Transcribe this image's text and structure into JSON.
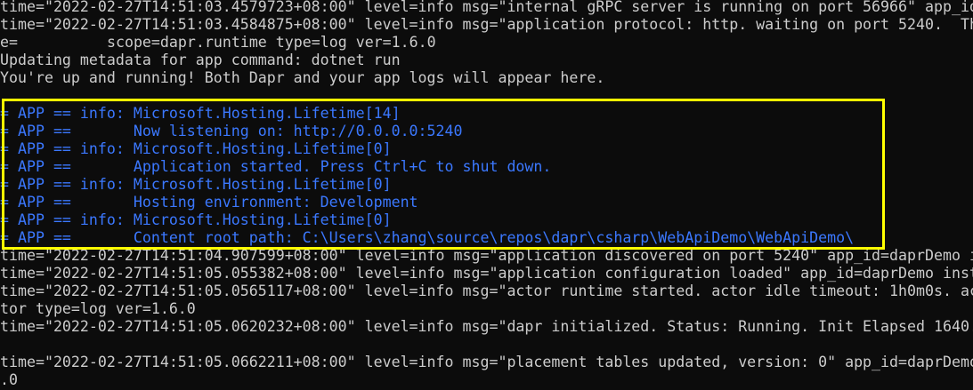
{
  "terminal": {
    "lines": {
      "l0": "time=\"2022-02-27T14:51:03.4579723+08:00\" level=info msg=\"internal gRPC server is running on port 56966\" app_id",
      "l1": "time=\"2022-02-27T14:51:03.4584875+08:00\" level=info msg=\"application protocol: http. waiting on port 5240.  Th",
      "l2_prefix": "e=",
      "l2_suffix": " scope=dapr.runtime type=log ver=1.6.0",
      "l3": "Updating metadata for app command: dotnet run",
      "l4": "You're up and running! Both Dapr and your app logs will appear here.",
      "l6": "= APP == info: Microsoft.Hosting.Lifetime[14]",
      "l7": "= APP ==       Now listening on: http://0.0.0.0:5240",
      "l8": "= APP == info: Microsoft.Hosting.Lifetime[0]",
      "l9": "= APP ==       Application started. Press Ctrl+C to shut down.",
      "l10": "= APP == info: Microsoft.Hosting.Lifetime[0]",
      "l11": "= APP ==       Hosting environment: Development",
      "l12": "= APP == info: Microsoft.Hosting.Lifetime[0]",
      "l13": "= APP ==       Content root path: C:\\Users\\zhang\\source\\repos\\dapr\\csharp\\WebApiDemo\\WebApiDemo\\",
      "l14": "time=\"2022-02-27T14:51:04.907599+08:00\" level=info msg=\"application discovered on port 5240\" app_id=daprDemo i",
      "l15": "time=\"2022-02-27T14:51:05.055382+08:00\" level=info msg=\"application configuration loaded\" app_id=daprDemo inst",
      "l16": "time=\"2022-02-27T14:51:05.0565117+08:00\" level=info msg=\"actor runtime started. actor idle timeout: 1h0m0s. ac",
      "l17": "tor type=log ver=1.6.0",
      "l18": "time=\"2022-02-27T14:51:05.0620232+08:00\" level=info msg=\"dapr initialized. Status: Running. Init Elapsed 1640.",
      "l20": "time=\"2022-02-27T14:51:05.0662211+08:00\" level=info msg=\"placement tables updated, version: 0\" app_id=daprDemo",
      "l21": ".0"
    }
  }
}
